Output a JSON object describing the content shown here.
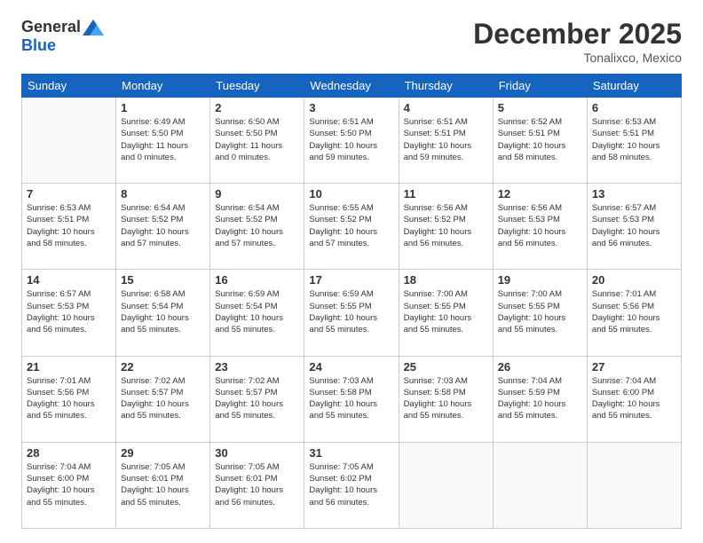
{
  "logo": {
    "general": "General",
    "blue": "Blue"
  },
  "header": {
    "month": "December 2025",
    "location": "Tonalixco, Mexico"
  },
  "weekdays": [
    "Sunday",
    "Monday",
    "Tuesday",
    "Wednesday",
    "Thursday",
    "Friday",
    "Saturday"
  ],
  "weeks": [
    [
      {
        "day": "",
        "info": ""
      },
      {
        "day": "1",
        "info": "Sunrise: 6:49 AM\nSunset: 5:50 PM\nDaylight: 11 hours\nand 0 minutes."
      },
      {
        "day": "2",
        "info": "Sunrise: 6:50 AM\nSunset: 5:50 PM\nDaylight: 11 hours\nand 0 minutes."
      },
      {
        "day": "3",
        "info": "Sunrise: 6:51 AM\nSunset: 5:50 PM\nDaylight: 10 hours\nand 59 minutes."
      },
      {
        "day": "4",
        "info": "Sunrise: 6:51 AM\nSunset: 5:51 PM\nDaylight: 10 hours\nand 59 minutes."
      },
      {
        "day": "5",
        "info": "Sunrise: 6:52 AM\nSunset: 5:51 PM\nDaylight: 10 hours\nand 58 minutes."
      },
      {
        "day": "6",
        "info": "Sunrise: 6:53 AM\nSunset: 5:51 PM\nDaylight: 10 hours\nand 58 minutes."
      }
    ],
    [
      {
        "day": "7",
        "info": "Sunrise: 6:53 AM\nSunset: 5:51 PM\nDaylight: 10 hours\nand 58 minutes."
      },
      {
        "day": "8",
        "info": "Sunrise: 6:54 AM\nSunset: 5:52 PM\nDaylight: 10 hours\nand 57 minutes."
      },
      {
        "day": "9",
        "info": "Sunrise: 6:54 AM\nSunset: 5:52 PM\nDaylight: 10 hours\nand 57 minutes."
      },
      {
        "day": "10",
        "info": "Sunrise: 6:55 AM\nSunset: 5:52 PM\nDaylight: 10 hours\nand 57 minutes."
      },
      {
        "day": "11",
        "info": "Sunrise: 6:56 AM\nSunset: 5:52 PM\nDaylight: 10 hours\nand 56 minutes."
      },
      {
        "day": "12",
        "info": "Sunrise: 6:56 AM\nSunset: 5:53 PM\nDaylight: 10 hours\nand 56 minutes."
      },
      {
        "day": "13",
        "info": "Sunrise: 6:57 AM\nSunset: 5:53 PM\nDaylight: 10 hours\nand 56 minutes."
      }
    ],
    [
      {
        "day": "14",
        "info": "Sunrise: 6:57 AM\nSunset: 5:53 PM\nDaylight: 10 hours\nand 56 minutes."
      },
      {
        "day": "15",
        "info": "Sunrise: 6:58 AM\nSunset: 5:54 PM\nDaylight: 10 hours\nand 55 minutes."
      },
      {
        "day": "16",
        "info": "Sunrise: 6:59 AM\nSunset: 5:54 PM\nDaylight: 10 hours\nand 55 minutes."
      },
      {
        "day": "17",
        "info": "Sunrise: 6:59 AM\nSunset: 5:55 PM\nDaylight: 10 hours\nand 55 minutes."
      },
      {
        "day": "18",
        "info": "Sunrise: 7:00 AM\nSunset: 5:55 PM\nDaylight: 10 hours\nand 55 minutes."
      },
      {
        "day": "19",
        "info": "Sunrise: 7:00 AM\nSunset: 5:55 PM\nDaylight: 10 hours\nand 55 minutes."
      },
      {
        "day": "20",
        "info": "Sunrise: 7:01 AM\nSunset: 5:56 PM\nDaylight: 10 hours\nand 55 minutes."
      }
    ],
    [
      {
        "day": "21",
        "info": "Sunrise: 7:01 AM\nSunset: 5:56 PM\nDaylight: 10 hours\nand 55 minutes."
      },
      {
        "day": "22",
        "info": "Sunrise: 7:02 AM\nSunset: 5:57 PM\nDaylight: 10 hours\nand 55 minutes."
      },
      {
        "day": "23",
        "info": "Sunrise: 7:02 AM\nSunset: 5:57 PM\nDaylight: 10 hours\nand 55 minutes."
      },
      {
        "day": "24",
        "info": "Sunrise: 7:03 AM\nSunset: 5:58 PM\nDaylight: 10 hours\nand 55 minutes."
      },
      {
        "day": "25",
        "info": "Sunrise: 7:03 AM\nSunset: 5:58 PM\nDaylight: 10 hours\nand 55 minutes."
      },
      {
        "day": "26",
        "info": "Sunrise: 7:04 AM\nSunset: 5:59 PM\nDaylight: 10 hours\nand 55 minutes."
      },
      {
        "day": "27",
        "info": "Sunrise: 7:04 AM\nSunset: 6:00 PM\nDaylight: 10 hours\nand 55 minutes."
      }
    ],
    [
      {
        "day": "28",
        "info": "Sunrise: 7:04 AM\nSunset: 6:00 PM\nDaylight: 10 hours\nand 55 minutes."
      },
      {
        "day": "29",
        "info": "Sunrise: 7:05 AM\nSunset: 6:01 PM\nDaylight: 10 hours\nand 55 minutes."
      },
      {
        "day": "30",
        "info": "Sunrise: 7:05 AM\nSunset: 6:01 PM\nDaylight: 10 hours\nand 56 minutes."
      },
      {
        "day": "31",
        "info": "Sunrise: 7:05 AM\nSunset: 6:02 PM\nDaylight: 10 hours\nand 56 minutes."
      },
      {
        "day": "",
        "info": ""
      },
      {
        "day": "",
        "info": ""
      },
      {
        "day": "",
        "info": ""
      }
    ]
  ]
}
